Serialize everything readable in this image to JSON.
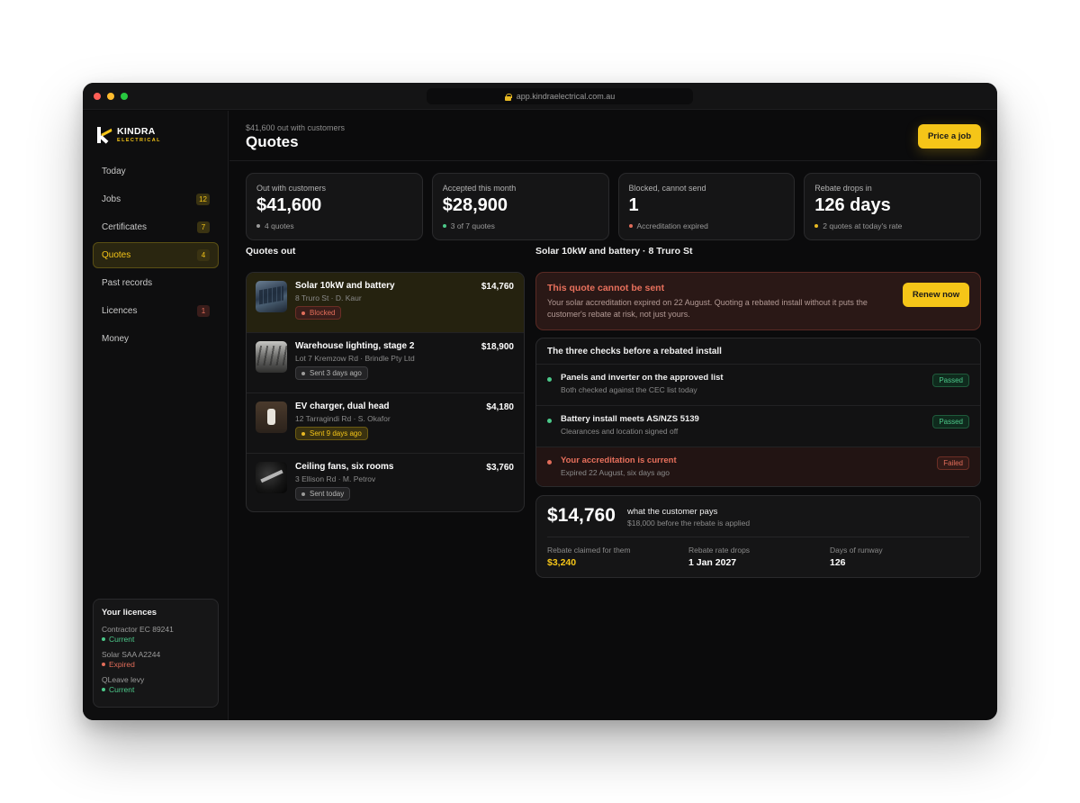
{
  "browser": {
    "url": "app.kindraelectrical.com.au"
  },
  "brand": {
    "name": "KINDRA",
    "sub": "ELECTRICAL"
  },
  "sidebar": {
    "items": [
      {
        "label": "Today",
        "count": ""
      },
      {
        "label": "Jobs",
        "count": "12"
      },
      {
        "label": "Certificates",
        "count": "7"
      },
      {
        "label": "Quotes",
        "count": "4"
      },
      {
        "label": "Past records",
        "count": ""
      },
      {
        "label": "Licences",
        "count": "1"
      },
      {
        "label": "Money",
        "count": ""
      }
    ],
    "active": "Quotes"
  },
  "licences": {
    "title": "Your licences",
    "items": [
      {
        "name": "Contractor EC 89241",
        "status": "Current"
      },
      {
        "name": "Solar SAA A2244",
        "status": "Expired"
      },
      {
        "name": "QLeave levy",
        "status": "Current"
      }
    ]
  },
  "header": {
    "subtitle": "$41,600 out with customers",
    "title": "Quotes",
    "primary_button": "Price a job"
  },
  "stats": [
    {
      "label": "Out with customers",
      "value": "$41,600",
      "foot": "4 quotes"
    },
    {
      "label": "Accepted this month",
      "value": "$28,900",
      "foot": "3 of 7 quotes"
    },
    {
      "label": "Blocked, cannot send",
      "value": "1",
      "foot": "Accreditation expired"
    },
    {
      "label": "Rebate drops in",
      "value": "126 days",
      "foot": "2 quotes at today's rate"
    }
  ],
  "quotes": {
    "title": "Quotes out",
    "items": [
      {
        "name": "Solar 10kW and battery",
        "address": "8 Truro St · D. Kaur",
        "amount": "$14,760",
        "status": "Blocked"
      },
      {
        "name": "Warehouse lighting, stage 2",
        "address": "Lot 7 Kremzow Rd · Brindle Pty Ltd",
        "amount": "$18,900",
        "status": "Sent 3 days ago"
      },
      {
        "name": "EV charger, dual head",
        "address": "12 Tarragindi Rd · S. Okafor",
        "amount": "$4,180",
        "status": "Sent 9 days ago"
      },
      {
        "name": "Ceiling fans, six rooms",
        "address": "3 Ellison Rd · M. Petrov",
        "amount": "$3,760",
        "status": "Sent today"
      }
    ]
  },
  "detail": {
    "title": "Solar 10kW and battery · 8 Truro St",
    "alert": {
      "title": "This quote cannot be sent",
      "body": "Your solar accreditation expired on 22 August. Quoting a rebated install without it puts the customer's rebate at risk, not just yours.",
      "button": "Renew now"
    },
    "checks": {
      "title": "The three checks before a rebated install",
      "items": [
        {
          "name": "Panels and inverter on the approved list",
          "sub": "Both checked against the CEC list today",
          "result": "Passed"
        },
        {
          "name": "Battery install meets AS/NZS 5139",
          "sub": "Clearances and location signed off",
          "result": "Passed"
        },
        {
          "name": "Your accreditation is current",
          "sub": "Expired 22 August, six days ago",
          "result": "Failed"
        }
      ]
    },
    "summary": {
      "total": "$14,760",
      "label": "what the customer pays",
      "note": "$18,000 before the rebate is applied",
      "columns": [
        {
          "label": "Rebate claimed for them",
          "value": "$3,240"
        },
        {
          "label": "Rebate rate drops",
          "value": "1 Jan 2027"
        },
        {
          "label": "Days of runway",
          "value": "126"
        }
      ]
    }
  },
  "colors": {
    "accent": "#f5c518",
    "danger": "#e26d5a",
    "success": "#4cc98a",
    "background": "#0b0b0c"
  }
}
